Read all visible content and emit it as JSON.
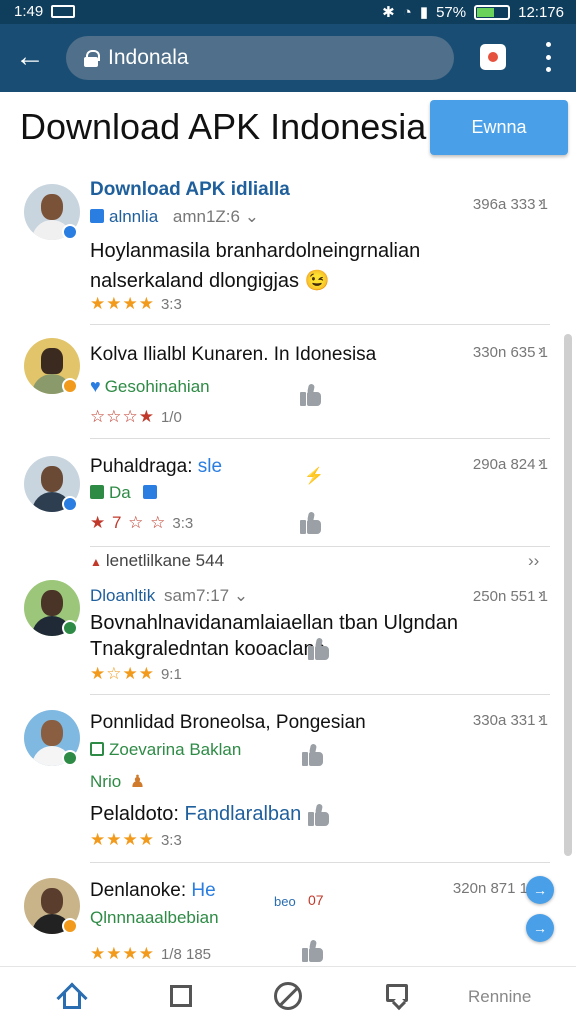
{
  "status_bar": {
    "time": "1:49",
    "battery": "57%",
    "clock": "12:176",
    "battery_level": 0.55
  },
  "toolbar": {
    "url_text": "Indonala"
  },
  "header": {
    "title": "Download APK Indonesia",
    "button_label": "Ewnna"
  },
  "items": [
    {
      "name": "Download APK idlialla",
      "meta": "alnnlia",
      "sub": "amn1Z:6 ⌄",
      "text_lines": [
        "Hoylanmasila branhardolneingrnalian",
        "nalserkaland dlongigjas 😉"
      ],
      "stars": "★★★★",
      "rating": "3:3",
      "time": "396a 333 1",
      "chevron": "›"
    },
    {
      "name": "Kolva Ilialbl Kunaren. In Idonesisa",
      "meta": "Gesohinahian",
      "text_lines": [],
      "stars": "☆☆☆★",
      "rating": "1/0",
      "time": "330n 635 1",
      "chevron": "›"
    },
    {
      "name": "Puhaldraga:",
      "name_accent": "sle",
      "meta": "Da",
      "text_lines": [],
      "stars": "★ 7 ☆ ☆",
      "rating": "3:3",
      "time": "290a 824 1",
      "chevron": "›"
    },
    {
      "name": "Dloanltik",
      "sub": "sam7:17 ⌄",
      "text_lines": [
        "Bovnahlnavidanamlaiaellan tban Ulgndan",
        "Tnakgraledntan kooaclans."
      ],
      "stars": "★☆★★",
      "rating": "9:1",
      "time": "250n 551 1",
      "chevron": "›"
    },
    {
      "name": "Ponnlidad Broneolsa, Pongesian",
      "meta": "Zoevarina Baklan",
      "meta2": "Nrio",
      "text_lines": [
        "Pelaldoto:"
      ],
      "text_accent": "Fandlaralban",
      "stars": "★★★★",
      "rating": "3:3",
      "time": "330a 331 1",
      "chevron": "›"
    },
    {
      "name": "Denlanoke:",
      "name_accent": "He",
      "meta": "Qlnnnaaalbebian",
      "tag": "beo",
      "tag2": "07",
      "text_lines": [],
      "stars": "★★★★",
      "rating": "1/8 185",
      "time": "320n 871 1",
      "chevron": "›"
    }
  ],
  "section_divider": {
    "label": "lenetlilkane 544",
    "chevron": "››"
  },
  "bottom_nav": {
    "label": "Rennine"
  },
  "colors": {
    "toolbar": "#1a4d73",
    "statusbar": "#0f3d5c",
    "accent_blue": "#4aa0e8",
    "link_blue": "#1f5f9c",
    "green": "#2e8b45",
    "star": "#f29a1c"
  }
}
